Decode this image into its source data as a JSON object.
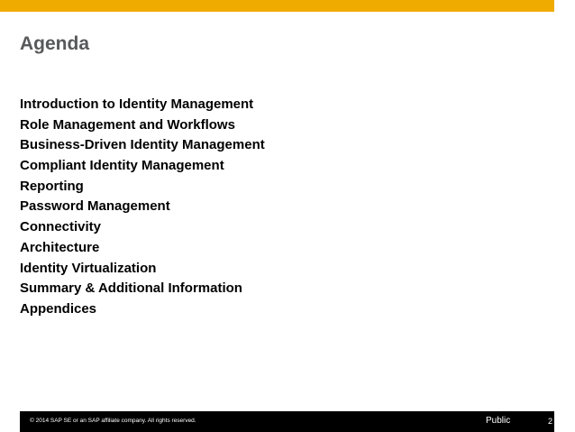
{
  "slide": {
    "title": "Agenda",
    "agenda": [
      "Introduction to Identity Management",
      "Role Management and Workflows",
      "Business-Driven Identity Management",
      "Compliant Identity Management",
      "Reporting",
      "Password Management",
      "Connectivity",
      "Architecture",
      "Identity Virtualization",
      "Summary & Additional Information",
      "Appendices"
    ]
  },
  "footer": {
    "copyright": "© 2014 SAP SE or an SAP affiliate company. All rights reserved.",
    "classification": "Public",
    "page_number": "2"
  },
  "colors": {
    "accent_bar": "#F0AB00",
    "title": "#58595B",
    "footer_bg": "#000000"
  }
}
